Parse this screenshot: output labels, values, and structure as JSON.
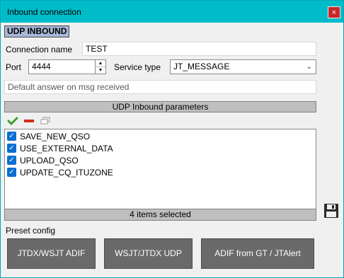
{
  "window": {
    "title": "Inbound connection",
    "close_label": "×"
  },
  "section_tag": "UDP INBOUND",
  "connection": {
    "label": "Connection name",
    "value": "TEST"
  },
  "port": {
    "label": "Port",
    "value": "4444"
  },
  "service": {
    "label": "Service type",
    "value": "JT_MESSAGE"
  },
  "default_answer": {
    "placeholder": "Default answer on msg received"
  },
  "params": {
    "header": "UDP Inbound parameters",
    "items": [
      {
        "label": "SAVE_NEW_QSO",
        "checked": true
      },
      {
        "label": "USE_EXTERNAL_DATA",
        "checked": true
      },
      {
        "label": "UPLOAD_QSO",
        "checked": true
      },
      {
        "label": "UPDATE_CQ_ITUZONE",
        "checked": true
      }
    ],
    "status": "4 items selected"
  },
  "preset": {
    "label": "Preset config",
    "buttons": [
      "JTDX/WSJT ADIF",
      "WSJT/JTDX UDP",
      "ADIF from GT / JTAlert"
    ]
  },
  "colors": {
    "titlebar": "#00bcc8",
    "close": "#c8282a",
    "checkbox": "#0b6fd1",
    "preset_button": "#6a6a6a"
  }
}
